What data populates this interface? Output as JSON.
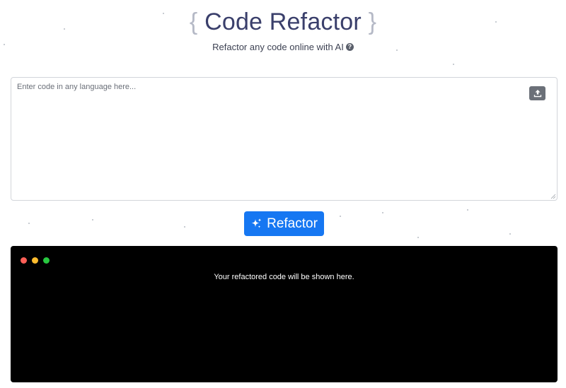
{
  "header": {
    "brace_open": "{",
    "title": "Code Refactor",
    "brace_close": "}",
    "subtitle": "Refactor any code online with AI",
    "help_icon": "question-circle-icon"
  },
  "editor": {
    "placeholder": "Enter code in any language here...",
    "value": "",
    "upload_icon": "upload-icon"
  },
  "actions": {
    "refactor_label": "Refactor",
    "refactor_icon": "sparkles-icon",
    "accent_color": "#1677f2"
  },
  "output": {
    "message": "Your refactored code will be shown here.",
    "window_controls": [
      "#ff5f57",
      "#febc2e",
      "#28c840"
    ]
  }
}
